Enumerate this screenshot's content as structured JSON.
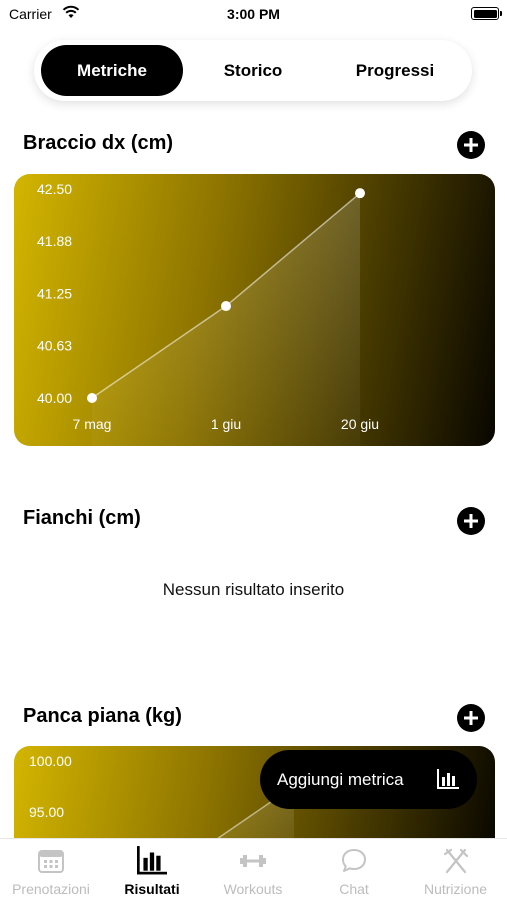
{
  "status_bar": {
    "carrier": "Carrier",
    "time": "3:00 PM"
  },
  "segmented": {
    "tabs": [
      {
        "label": "Metriche",
        "active": true
      },
      {
        "label": "Storico",
        "active": false
      },
      {
        "label": "Progressi",
        "active": false
      }
    ]
  },
  "sections": [
    {
      "title": "Braccio dx (cm)",
      "chart_data": {
        "type": "line",
        "x": [
          "7 mag",
          "1 giu",
          "20 giu"
        ],
        "y": [
          40.0,
          41.1,
          42.45
        ],
        "yticks": [
          "40.00",
          "40.63",
          "41.25",
          "41.88",
          "42.50"
        ],
        "ylim": [
          40.0,
          42.5
        ]
      }
    },
    {
      "title": "Fianchi (cm)",
      "empty_message": "Nessun risultato inserito"
    },
    {
      "title": "Panca piana (kg)",
      "chart_data": {
        "type": "line",
        "yticks": [
          "100.00",
          "95.00"
        ]
      }
    }
  ],
  "fab": {
    "label": "Aggiungi metrica",
    "icon": "bar-chart-icon"
  },
  "tab_bar": {
    "items": [
      {
        "label": "Prenotazioni",
        "icon": "calendar-icon",
        "active": false
      },
      {
        "label": "Risultati",
        "icon": "bar-chart-icon",
        "active": true
      },
      {
        "label": "Workouts",
        "icon": "dumbbell-icon",
        "active": false
      },
      {
        "label": "Chat",
        "icon": "chat-bubble-icon",
        "active": false
      },
      {
        "label": "Nutrizione",
        "icon": "fork-knife-icon",
        "active": false
      }
    ]
  },
  "colors": {
    "accent": "#d3b500",
    "dark": "#000000",
    "inactive": "#bcbcbc"
  }
}
